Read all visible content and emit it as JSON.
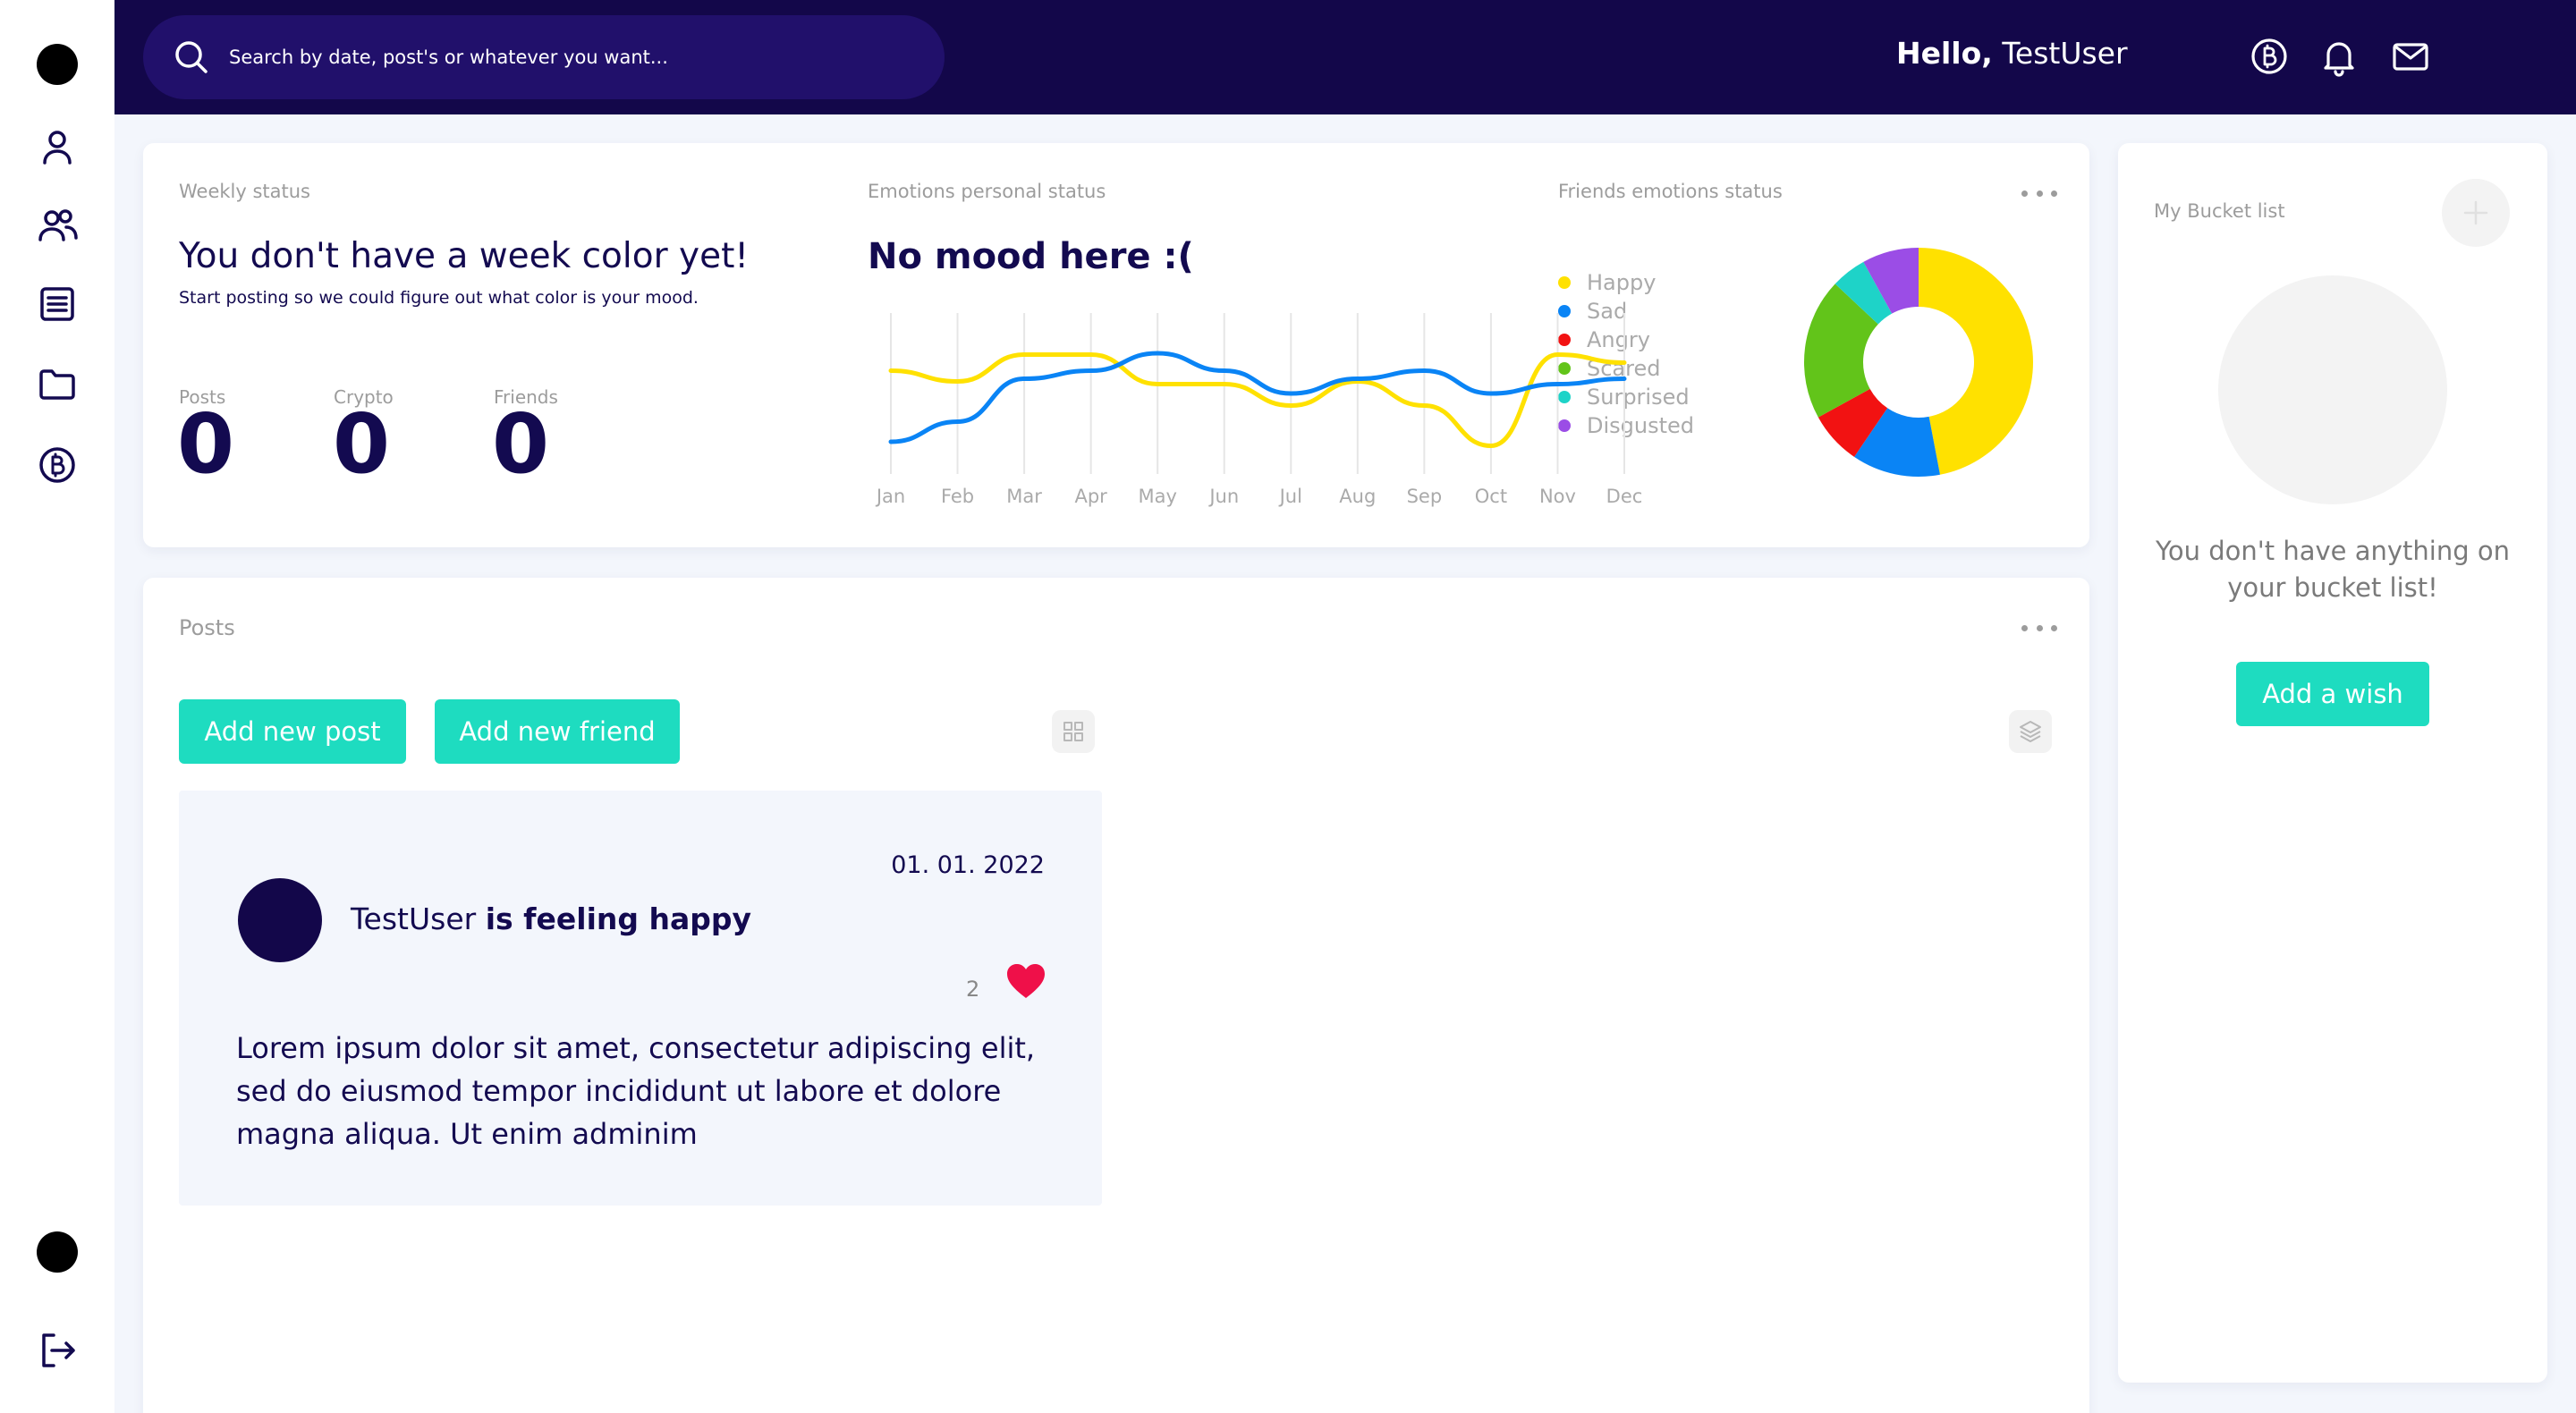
{
  "search": {
    "placeholder": "Search by date, post's or whatever you want..."
  },
  "header": {
    "greeting": "Hello,",
    "username": "TestUser"
  },
  "sidebar": {
    "items": [
      {
        "name": "profile",
        "icon": "user-icon"
      },
      {
        "name": "friends",
        "icon": "users-icon"
      },
      {
        "name": "posts",
        "icon": "list-icon"
      },
      {
        "name": "files",
        "icon": "folder-icon"
      },
      {
        "name": "crypto",
        "icon": "bitcoin-icon"
      }
    ],
    "bottom": [
      {
        "name": "logout",
        "icon": "logout-icon"
      }
    ]
  },
  "top_icons": [
    "bitcoin-icon",
    "bell-icon",
    "mail-icon"
  ],
  "weekly": {
    "label": "Weekly status",
    "title": "You don't have a week color yet!",
    "subtitle": "Start posting so we could figure out what color is your mood.",
    "stats": [
      {
        "label": "Posts",
        "value": "0"
      },
      {
        "label": "Crypto",
        "value": "0"
      },
      {
        "label": "Friends",
        "value": "0"
      }
    ]
  },
  "emotions": {
    "label": "Emotions personal status",
    "title": "No mood here :("
  },
  "friends_emotions": {
    "label": "Friends emotions status",
    "legend": [
      {
        "name": "Happy",
        "color": "#ffe100"
      },
      {
        "name": "Sad",
        "color": "#0a84f5"
      },
      {
        "name": "Angry",
        "color": "#f21212"
      },
      {
        "name": "Scared",
        "color": "#62c41a"
      },
      {
        "name": "Surprised",
        "color": "#1ed3c8"
      },
      {
        "name": "Disgusted",
        "color": "#9b4de6"
      }
    ]
  },
  "posts": {
    "label": "Posts",
    "add_post": "Add new post",
    "add_friend": "Add new friend",
    "items": [
      {
        "date": "01. 01. 2022",
        "author": "TestUser",
        "feeling": "is feeling happy",
        "likes": "2",
        "body": "Lorem ipsum dolor sit amet, consectetur adipiscing elit, sed do eiusmod tempor incididunt ut labore et dolore magna aliqua. Ut enim adminim"
      }
    ]
  },
  "bucket": {
    "label": "My Bucket list",
    "empty": "You don't have anything on your bucket list!",
    "add_wish": "Add a wish"
  },
  "chart_data": [
    {
      "type": "line",
      "x": [
        "Jan",
        "Feb",
        "Mar",
        "Apr",
        "May",
        "Jun",
        "Jul",
        "Aug",
        "Sep",
        "Oct",
        "Nov",
        "Dec"
      ],
      "series": [
        {
          "color": "#ffe100",
          "values": [
            7.7,
            6.9,
            8.9,
            8.9,
            6.7,
            6.7,
            5.1,
            6.9,
            5.1,
            2.1,
            8.9,
            8.3
          ]
        },
        {
          "color": "#0a84f5",
          "values": [
            2.4,
            3.9,
            7.1,
            7.7,
            9.0,
            7.7,
            6.0,
            7.1,
            7.7,
            6.0,
            6.7,
            7.1
          ]
        }
      ],
      "ylim": [
        0,
        12
      ],
      "grid": "vertical"
    },
    {
      "type": "pie",
      "donut": true,
      "categories": [
        "Happy",
        "Sad",
        "Angry",
        "Scared",
        "Surprised",
        "Disgusted"
      ],
      "values": [
        47,
        12.5,
        7.5,
        20,
        5,
        8
      ],
      "colors": [
        "#ffe100",
        "#0a84f5",
        "#f21212",
        "#62c41a",
        "#1ed3c8",
        "#9b4de6"
      ]
    }
  ]
}
